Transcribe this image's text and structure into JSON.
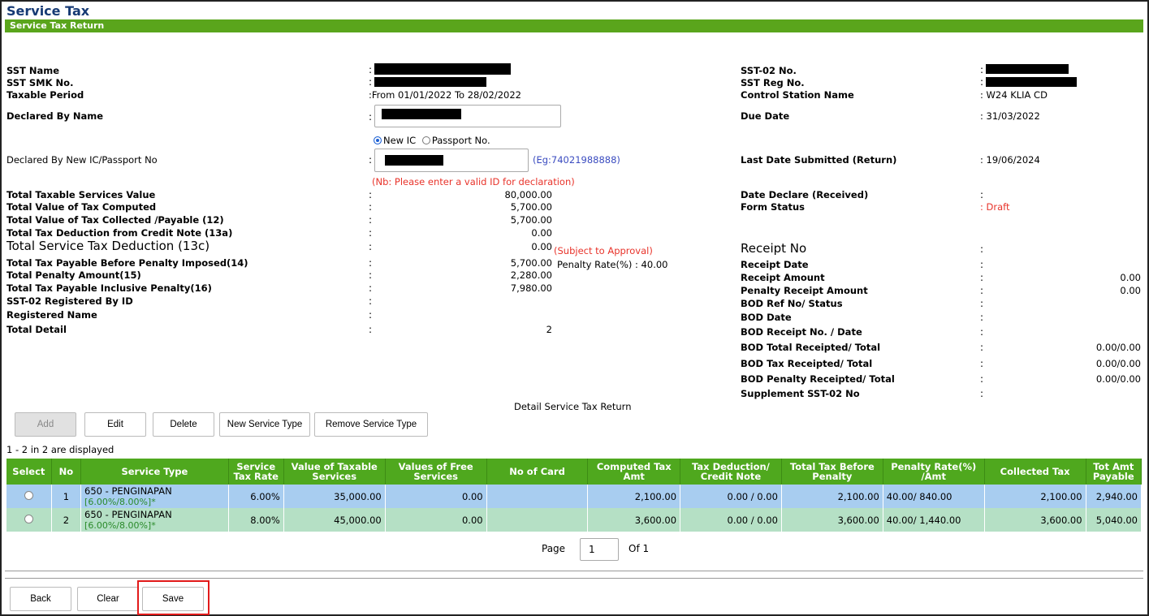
{
  "header": {
    "title": "Service Tax",
    "subtitle": "Service Tax Return"
  },
  "left": {
    "sst_name": "SST Name",
    "sst_smk": "SST SMK No.",
    "taxable_period": "Taxable Period",
    "taxable_period_value": ":From 01/01/2022 To 28/02/2022",
    "declared_by_name": "Declared By Name",
    "id_new_ic": "New IC",
    "id_passport": "Passport No.",
    "declared_by_ic": "Declared By New IC/Passport No",
    "ic_example": "(Eg:74021988888)",
    "ic_note": "(Nb: Please enter a valid ID for declaration)",
    "rows": [
      {
        "label": "Total Taxable Services Value",
        "value": "80,000.00"
      },
      {
        "label": "Total Value of Tax Computed",
        "value": "5,700.00"
      },
      {
        "label": "Total Value of Tax Collected /Payable (12)",
        "value": "5,700.00"
      },
      {
        "label": "Total Tax Deduction from Credit Note (13a)",
        "value": "0.00"
      },
      {
        "label": "Total Service Tax Deduction (13c)",
        "value": "0.00"
      },
      {
        "label": "Total Tax Payable Before Penalty Imposed(14)",
        "value": "5,700.00"
      },
      {
        "label": "Total Penalty Amount(15)",
        "value": "2,280.00"
      },
      {
        "label": "Total Tax Payable Inclusive Penalty(16)",
        "value": "7,980.00"
      },
      {
        "label": "SST-02 Registered By ID",
        "value": ""
      },
      {
        "label": "Registered Name",
        "value": ""
      },
      {
        "label": "Total Detail",
        "value": "2"
      }
    ],
    "subject_approval": "(Subject to Approval)",
    "penalty_rate": "Penalty Rate(%) : 40.00"
  },
  "right": {
    "sst02_no": "SST-02 No.",
    "sst_reg_no": "SST Reg No.",
    "control_station": "Control Station Name",
    "control_station_value": ": W24 KLIA CD",
    "due_date": "Due Date",
    "due_date_value": ": 31/03/2022",
    "last_date": "Last Date Submitted (Return)",
    "last_date_value": ": 19/06/2024",
    "date_declare": "Date Declare (Received)",
    "form_status": "Form Status",
    "form_status_value": ": Draft",
    "rows": [
      {
        "label": "Receipt No",
        "value": ""
      },
      {
        "label": "Receipt Date",
        "value": ""
      },
      {
        "label": "Receipt Amount",
        "value": "0.00"
      },
      {
        "label": "Penalty Receipt Amount",
        "value": "0.00"
      },
      {
        "label": "BOD Ref No/ Status",
        "value": ""
      },
      {
        "label": "BOD Date",
        "value": ""
      },
      {
        "label": "BOD Receipt No. / Date",
        "value": ""
      },
      {
        "label": "BOD Total Receipted/ Total",
        "value": "0.00/0.00"
      },
      {
        "label": "BOD Tax Receipted/ Total",
        "value": "0.00/0.00"
      },
      {
        "label": "BOD Penalty Receipted/ Total",
        "value": "0.00/0.00"
      },
      {
        "label": "Supplement SST-02 No",
        "value": ""
      }
    ]
  },
  "detail_title": "Detail Service Tax Return",
  "buttons": {
    "add": "Add",
    "edit": "Edit",
    "delete": "Delete",
    "new_service": "New Service Type",
    "remove_service": "Remove Service Type"
  },
  "displayed": "1 - 2 in 2 are displayed",
  "table": {
    "headers": [
      "Select",
      "No",
      "Service Type",
      "Service Tax Rate",
      "Value of Taxable Services",
      "Values of Free Services",
      "No of Card",
      "Computed Tax Amt",
      "Tax Deduction/ Credit Note",
      "Total Tax Before Penalty",
      "Penalty Rate(%) /Amt",
      "Collected Tax",
      "Tot Amt Payable"
    ],
    "rows": [
      {
        "no": "1",
        "service": "650 - PENGINAPAN",
        "service_rates": "[6.00%/8.00%]*",
        "rate": "6.00%",
        "taxable": "35,000.00",
        "free": "0.00",
        "cards": "",
        "computed": "2,100.00",
        "deduction": "0.00 / 0.00",
        "before_penalty": "2,100.00",
        "penalty": "40.00/ 840.00",
        "collected": "2,100.00",
        "total": "2,940.00"
      },
      {
        "no": "2",
        "service": "650 - PENGINAPAN",
        "service_rates": "[6.00%/8.00%]*",
        "rate": "8.00%",
        "taxable": "45,000.00",
        "free": "0.00",
        "cards": "",
        "computed": "3,600.00",
        "deduction": "0.00 / 0.00",
        "before_penalty": "3,600.00",
        "penalty": "40.00/ 1,440.00",
        "collected": "3,600.00",
        "total": "5,040.00"
      }
    ]
  },
  "pager": {
    "page_label": "Page",
    "page_value": "1",
    "of_label": "Of 1"
  },
  "footer": {
    "back": "Back",
    "clear": "Clear",
    "save": "Save"
  }
}
